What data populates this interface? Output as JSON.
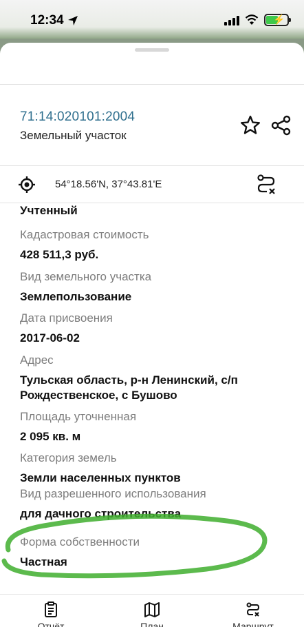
{
  "status_bar": {
    "time": "12:34",
    "icons": [
      "location-arrow-icon",
      "signal-icon",
      "wifi-icon",
      "battery-charging-icon"
    ]
  },
  "object": {
    "cadastral_number": "71:14:020101:2004",
    "type": "Земельный участок",
    "coordinates": "54°18.56'N, 37°43.81'E"
  },
  "properties": [
    {
      "label": "",
      "value": "Учтенный"
    },
    {
      "label": "Кадастровая стоимость",
      "value": "428 511,3 руб."
    },
    {
      "label": "Вид земельного участка",
      "value": "Землепользование"
    },
    {
      "label": "Дата присвоения",
      "value": "2017-06-02"
    },
    {
      "label": "Адрес",
      "value": "Тульская область, р-н Ленинский, с/п Рождественское, с Бушово"
    },
    {
      "label": "Площадь уточненная",
      "value": "2 095 кв. м"
    },
    {
      "label": "Категория земель",
      "value": "Земли населенных пунктов"
    },
    {
      "label": "Вид разрешенного использования",
      "value": "для дачного строительства"
    },
    {
      "label": "Форма собственности",
      "value": "Частная"
    }
  ],
  "tabs": [
    {
      "label": "Отчёт",
      "icon": "report-icon"
    },
    {
      "label": "План",
      "icon": "map-icon"
    },
    {
      "label": "Маршрут",
      "icon": "route-icon"
    }
  ],
  "colors": {
    "cadastral_link": "#2f6f8e",
    "label_gray": "#7d7d7d",
    "highlight_green": "#3fae2e"
  }
}
